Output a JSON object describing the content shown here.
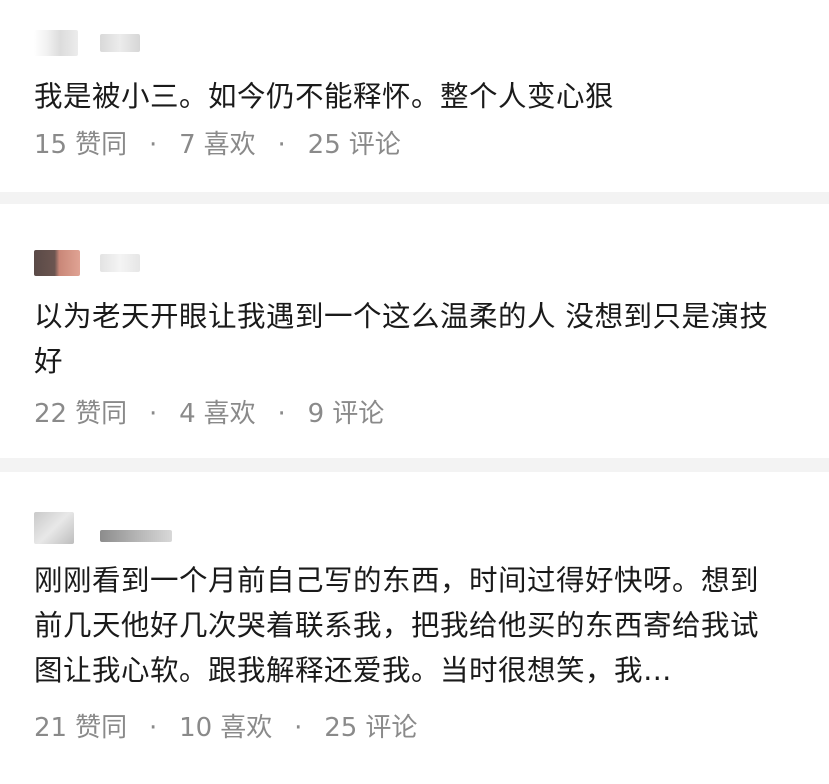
{
  "comments": [
    {
      "text": "我是被小三。如今仍不能释怀。整个人变心狠",
      "likes": "15",
      "likes_label": "赞同",
      "favorites": "7",
      "favorites_label": "喜欢",
      "replies": "25",
      "replies_label": "评论"
    },
    {
      "text": "以为老天开眼让我遇到一个这么温柔的人 没想到只是演技好",
      "likes": "22",
      "likes_label": "赞同",
      "favorites": "4",
      "favorites_label": "喜欢",
      "replies": "9",
      "replies_label": "评论"
    },
    {
      "text": "刚刚看到一个月前自己写的东西，时间过得好快呀。想到前几天他好几次哭着联系我，把我给他买的东西寄给我试图让我心软。跟我解释还爱我。当时很想笑，我…",
      "likes": "21",
      "likes_label": "赞同",
      "favorites": "10",
      "favorites_label": "喜欢",
      "replies": "25",
      "replies_label": "评论"
    }
  ],
  "separator": "·",
  "colors": {
    "text": "#1a1a1a",
    "meta": "#8a8a8a",
    "divider": "#f3f3f3",
    "background": "#ffffff"
  }
}
